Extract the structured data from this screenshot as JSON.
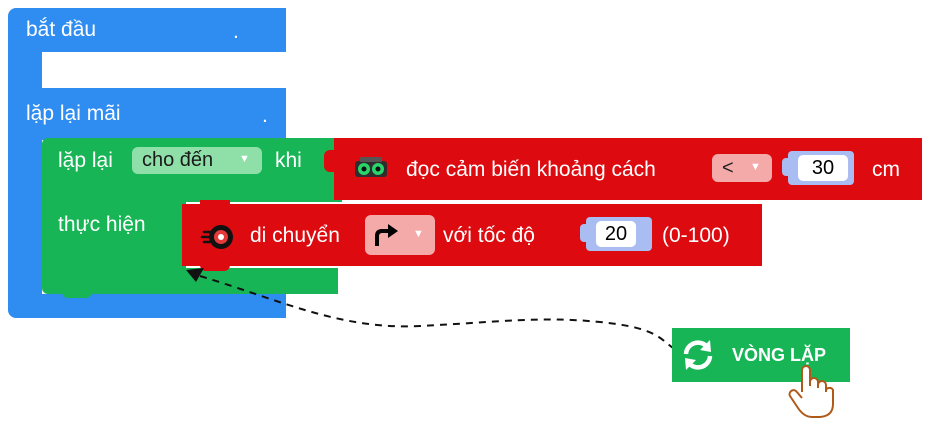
{
  "blocks": {
    "start": {
      "label": "bắt đầu",
      "dot": "."
    },
    "forever": {
      "label": "lặp lại mãi",
      "dot": "."
    },
    "repeat_until": {
      "label_repeat": "lặp lại",
      "mode_value": "cho đến",
      "label_when": "khi",
      "label_do": "thực hiện"
    },
    "sensor": {
      "label": "đọc cảm biến khoảng cách",
      "operator": "<",
      "value": "30",
      "unit": "cm"
    },
    "move": {
      "label": "di chuyển",
      "label_speed": "với tốc độ",
      "speed": "20",
      "range": "(0-100)"
    }
  },
  "toolbox": {
    "loop_label": "VÒNG LẶP"
  },
  "colors": {
    "control": "#2f8cf0",
    "loop": "#17b556",
    "motion": "#dd0a0f"
  },
  "icons": [
    "ultrasonic-sensor-icon",
    "wheel-icon",
    "turn-right-arrow-icon",
    "dropdown-arrow-icon",
    "loop-refresh-icon",
    "pointing-hand-icon"
  ]
}
